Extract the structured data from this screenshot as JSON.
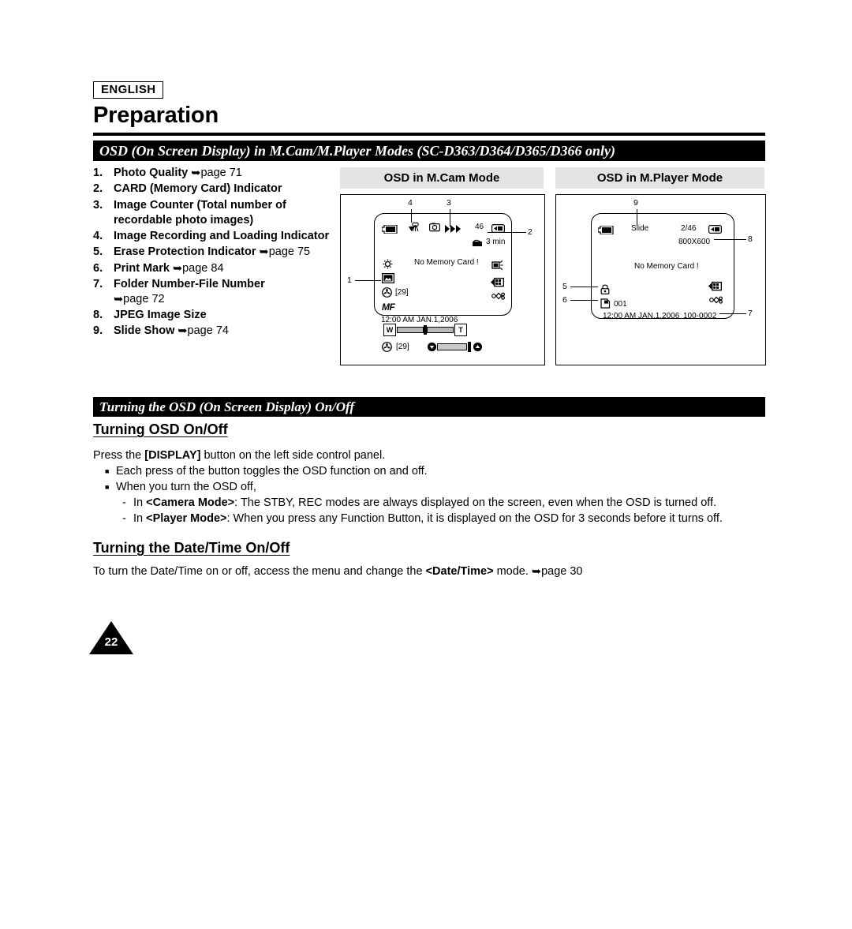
{
  "header": {
    "language_badge": "ENGLISH",
    "chapter_title": "Preparation"
  },
  "section_osd": {
    "bar_title": "OSD (On Screen Display) in M.Cam/M.Player Modes (SC-D363/D364/D365/D366 only)",
    "items": [
      {
        "num": "1.",
        "label": "Photo Quality ",
        "ref": "page 71",
        "has_arrow": true
      },
      {
        "num": "2.",
        "label": "CARD (Memory Card) Indicator",
        "ref": "",
        "has_arrow": false
      },
      {
        "num": "3.",
        "label": "Image Counter (Total number of recordable photo images)",
        "ref": "",
        "has_arrow": false
      },
      {
        "num": "4.",
        "label": "Image Recording and Loading Indicator",
        "ref": "",
        "has_arrow": false
      },
      {
        "num": "5.",
        "label": "Erase Protection Indicator ",
        "ref": "page 75",
        "has_arrow": true
      },
      {
        "num": "6.",
        "label": "Print Mark ",
        "ref": "page 84",
        "has_arrow": true
      },
      {
        "num": "7.",
        "label": "Folder Number-File Number",
        "ref": "page 72",
        "has_arrow": true
      },
      {
        "num": "8.",
        "label": "JPEG Image Size",
        "ref": "",
        "has_arrow": false
      },
      {
        "num": "9.",
        "label": "Slide Show ",
        "ref": "page 74",
        "has_arrow": true
      }
    ]
  },
  "diagram_mcam": {
    "title": "OSD in M.Cam Mode",
    "message": "No Memory Card !",
    "counter": "46",
    "record_time": "3 min",
    "aperture_count": "[29]",
    "focus_mode": "MF",
    "datetime": "12:00 AM JAN.1,2006",
    "zoom_w": "W",
    "zoom_t": "T",
    "slider_count": "[29]",
    "callouts": [
      "1",
      "2",
      "3",
      "4"
    ],
    "icons": [
      "battery-icon",
      "macro-flower-icon",
      "photo-camera-icon",
      "image-recording-arrows-icon",
      "memory-card-icon",
      "folder-time-icon",
      "sun-gear-icon",
      "photo-quality-icon",
      "aperture-fan-icon",
      "backlight-icon",
      "jpeg-size-icon",
      "effect-icon"
    ]
  },
  "diagram_mplayer": {
    "title": "OSD in M.Player Mode",
    "message": "No Memory Card !",
    "slide_label": "Slide",
    "counter": "2/46",
    "image_size": "800X600",
    "print_mark_count": "001",
    "datetime": "12:00 AM JAN.1,2006",
    "file_number": "100-0002",
    "callouts": [
      "5",
      "6",
      "7",
      "8",
      "9"
    ],
    "icons": [
      "battery-icon",
      "memory-card-icon",
      "erase-protection-lock-icon",
      "print-mark-icon",
      "jpeg-size-icon",
      "effect-icon"
    ]
  },
  "section_turning": {
    "bar_title": "Turning the OSD (On Screen Display) On/Off",
    "heading_osd": "Turning OSD On/Off",
    "press_line_pre": "Press the ",
    "press_line_key": "[DISPLAY]",
    "press_line_post": " button on the left side control panel.",
    "bullet_1": "Each press of the button toggles the OSD function on and off.",
    "bullet_2": "When you turn the OSD off,",
    "dash_1_pre": "In ",
    "dash_1_mode": "<Camera Mode>",
    "dash_1_post": ": The STBY, REC modes are always displayed on the screen, even when the OSD is turned off.",
    "dash_2_pre": "In ",
    "dash_2_mode": "<Player Mode>",
    "dash_2_post": ": When you press any Function Button, it is displayed on the OSD for 3 seconds before it turns off.",
    "heading_datetime": "Turning the Date/Time On/Off",
    "datetime_pre": "To turn the Date/Time on or off, access the menu and change the ",
    "datetime_mode": "<Date/Time>",
    "datetime_post": " mode. ",
    "datetime_ref": "page 30"
  },
  "footer": {
    "page_number": "22"
  }
}
